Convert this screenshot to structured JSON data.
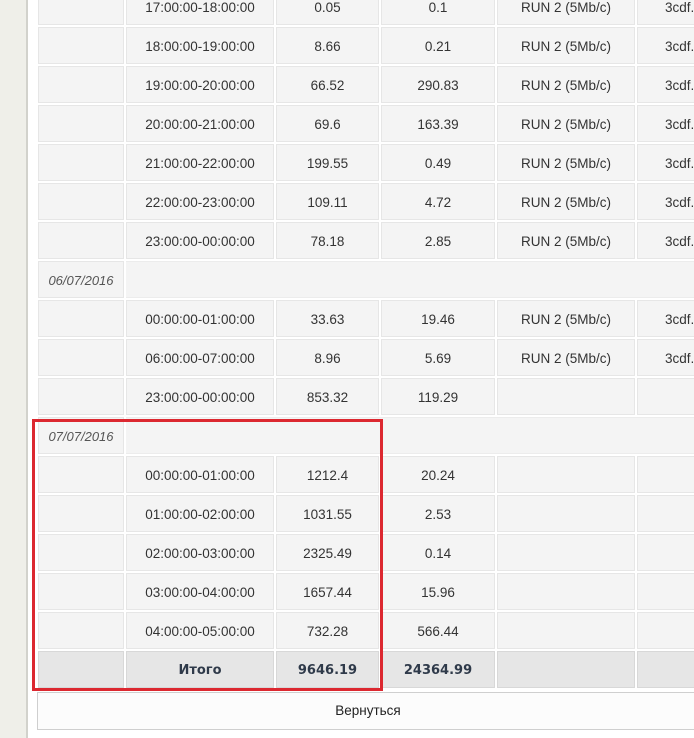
{
  "table": {
    "rows": [
      {
        "kind": "hour",
        "time": "17:00:00-18:00:00",
        "v1": "0.05",
        "v2": "0.1",
        "run": "RUN 2 (5Mb/c)",
        "file": "3cdf."
      },
      {
        "kind": "hour",
        "time": "18:00:00-19:00:00",
        "v1": "8.66",
        "v2": "0.21",
        "run": "RUN 2 (5Mb/c)",
        "file": "3cdf."
      },
      {
        "kind": "hour",
        "time": "19:00:00-20:00:00",
        "v1": "66.52",
        "v2": "290.83",
        "run": "RUN 2 (5Mb/c)",
        "file": "3cdf."
      },
      {
        "kind": "hour",
        "time": "20:00:00-21:00:00",
        "v1": "69.6",
        "v2": "163.39",
        "run": "RUN 2 (5Mb/c)",
        "file": "3cdf."
      },
      {
        "kind": "hour",
        "time": "21:00:00-22:00:00",
        "v1": "199.55",
        "v2": "0.49",
        "run": "RUN 2 (5Mb/c)",
        "file": "3cdf."
      },
      {
        "kind": "hour",
        "time": "22:00:00-23:00:00",
        "v1": "109.11",
        "v2": "4.72",
        "run": "RUN 2 (5Mb/c)",
        "file": "3cdf."
      },
      {
        "kind": "hour",
        "time": "23:00:00-00:00:00",
        "v1": "78.18",
        "v2": "2.85",
        "run": "RUN 2 (5Mb/c)",
        "file": "3cdf."
      },
      {
        "kind": "date",
        "date": "06/07/2016"
      },
      {
        "kind": "hour",
        "time": "00:00:00-01:00:00",
        "v1": "33.63",
        "v2": "19.46",
        "run": "RUN 2 (5Mb/c)",
        "file": "3cdf."
      },
      {
        "kind": "hour",
        "time": "06:00:00-07:00:00",
        "v1": "8.96",
        "v2": "5.69",
        "run": "RUN 2 (5Mb/c)",
        "file": "3cdf."
      },
      {
        "kind": "hour",
        "time": "23:00:00-00:00:00",
        "v1": "853.32",
        "v2": "119.29",
        "run": "",
        "file": ""
      },
      {
        "kind": "date",
        "date": "07/07/2016"
      },
      {
        "kind": "hour",
        "time": "00:00:00-01:00:00",
        "v1": "1212.4",
        "v2": "20.24",
        "run": "",
        "file": ""
      },
      {
        "kind": "hour",
        "time": "01:00:00-02:00:00",
        "v1": "1031.55",
        "v2": "2.53",
        "run": "",
        "file": ""
      },
      {
        "kind": "hour",
        "time": "02:00:00-03:00:00",
        "v1": "2325.49",
        "v2": "0.14",
        "run": "",
        "file": ""
      },
      {
        "kind": "hour",
        "time": "03:00:00-04:00:00",
        "v1": "1657.44",
        "v2": "15.96",
        "run": "",
        "file": ""
      },
      {
        "kind": "hour",
        "time": "04:00:00-05:00:00",
        "v1": "732.28",
        "v2": "566.44",
        "run": "",
        "file": ""
      }
    ],
    "total": {
      "label": "Итого",
      "v1": "9646.19",
      "v2": "24364.99"
    }
  },
  "back_button": {
    "label": "Вернуться"
  },
  "colors": {
    "highlight": "#dc2830",
    "page_bg": "#efefe9",
    "cell_bg": "#f4f4f4"
  }
}
